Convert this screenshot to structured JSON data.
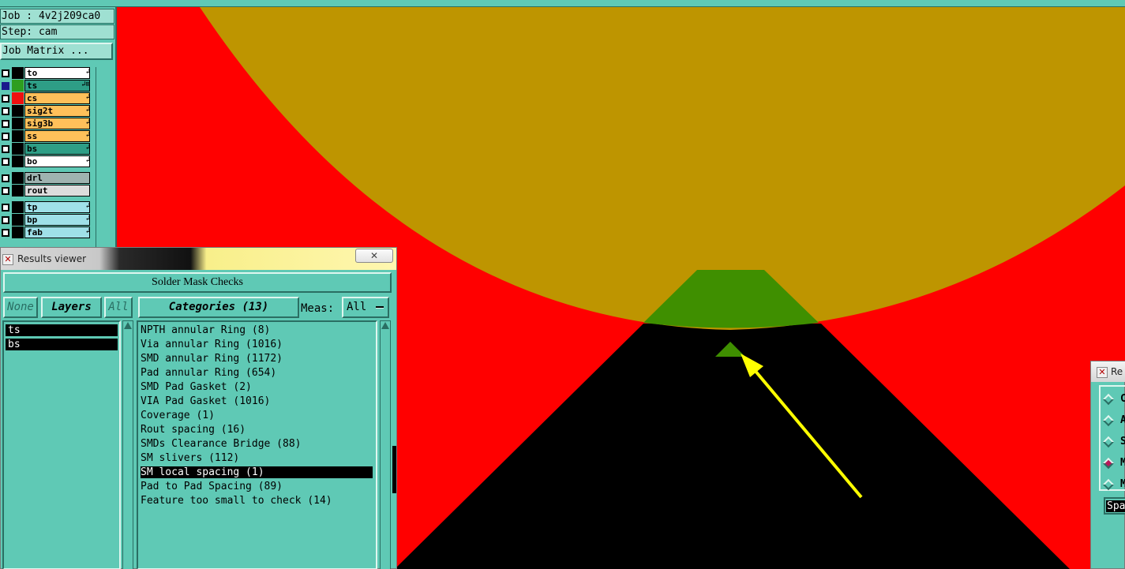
{
  "job": {
    "job_line": "Job : 4v2j209ca0",
    "step_line": "Step: cam",
    "matrix_button": "Job Matrix ..."
  },
  "layers": [
    {
      "name": "to",
      "checked": false,
      "color": "#ffffff",
      "swatch": "#000000",
      "arrow": "↲"
    },
    {
      "name": "ts",
      "checked": true,
      "color": "#2e9e86",
      "swatch": "#2e9e1f",
      "arrow": "↲⊞"
    },
    {
      "name": "cs",
      "checked": false,
      "color": "#ffc05a",
      "swatch": "#ee1010",
      "arrow": "↲"
    },
    {
      "name": "sig2t",
      "checked": false,
      "color": "#ffc05a",
      "swatch": "#000000",
      "arrow": "↲"
    },
    {
      "name": "sig3b",
      "checked": false,
      "color": "#ffc05a",
      "swatch": "#000000",
      "arrow": "↲"
    },
    {
      "name": "ss",
      "checked": false,
      "color": "#ffc05a",
      "swatch": "#000000",
      "arrow": "↲"
    },
    {
      "name": "bs",
      "checked": false,
      "color": "#2e9e86",
      "swatch": "#000000",
      "arrow": "↲"
    },
    {
      "name": "bo",
      "checked": false,
      "color": "#ffffff",
      "swatch": "#000000",
      "arrow": "↲"
    },
    {
      "name": "drl",
      "checked": false,
      "color": "#9fb3b0",
      "swatch": "#000000",
      "arrow": ""
    },
    {
      "name": "rout",
      "checked": false,
      "color": "#dcdcdc",
      "swatch": "#000000",
      "arrow": ""
    },
    {
      "name": "tp",
      "checked": false,
      "color": "#9fe0e8",
      "swatch": "#000000",
      "arrow": "↲"
    },
    {
      "name": "bp",
      "checked": false,
      "color": "#9fe0e8",
      "swatch": "#000000",
      "arrow": "↲"
    },
    {
      "name": "fab",
      "checked": false,
      "color": "#9fe0e8",
      "swatch": "#000000",
      "arrow": "↲"
    }
  ],
  "results_viewer": {
    "title": "Results viewer",
    "close_icon": "✕",
    "header": "Solder Mask Checks",
    "none_label": "None",
    "layers_label": "Layers",
    "all_label": "All",
    "categories_label": "Categories (13)",
    "meas_label": "Meas:",
    "meas_value": "All",
    "result_layers": [
      "ts",
      "bs"
    ],
    "categories": [
      "NPTH annular Ring (8)",
      "Via annular Ring (1016)",
      "SMD annular Ring (1172)",
      "Pad annular Ring (654)",
      "SMD Pad Gasket (2)",
      "VIA Pad Gasket (1016)",
      "Coverage (1)",
      "Rout spacing (16)",
      "SMDs Clearance Bridge (88)",
      "SM slivers (112)",
      "SM local spacing (1)",
      "Pad to Pad Spacing (89)",
      "Feature too small to check (14)"
    ],
    "selected_category_index": 10
  },
  "right_window": {
    "title": "Re",
    "options": [
      "C",
      "A",
      "S",
      "M",
      "M"
    ],
    "selected_option_index": 3,
    "field_text": "Spa"
  },
  "colors": {
    "panel": "#5fc9b5",
    "canvas_red": "#ff0000",
    "canvas_gold": "#be9500",
    "canvas_green": "#3f8f00",
    "arrow_yellow": "#ffff00"
  }
}
